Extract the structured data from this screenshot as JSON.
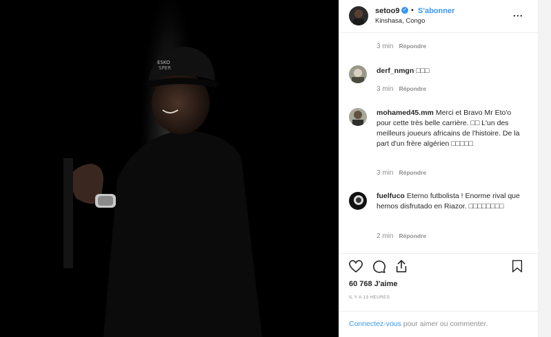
{
  "post": {
    "username": "setoo9",
    "separator": "•",
    "follow_label": "S'abonner",
    "location": "Kinshasa, Congo",
    "more_icon": "..."
  },
  "comments": [
    {
      "username": "",
      "text": "",
      "time": "3 min",
      "reply_label": "Répondre"
    },
    {
      "username": "derf_nmgn",
      "text": "□□□",
      "time": "3 min",
      "reply_label": "Répondre"
    },
    {
      "username": "mohamed45.mm",
      "text": "Merci et Bravo Mr Eto'o pour cette très belle carrière. □□ L'un des meilleurs joueurs africains de l'histoire. De la part d'un frère algérien □□□□□",
      "time": "3 min",
      "reply_label": "Répondre"
    },
    {
      "username": "fuelfuco",
      "text": "Eterno futbolista ! Enorme rival que hemos disfrutado en Riazor. □□□□□□□□",
      "time": "2 min",
      "reply_label": "Répondre"
    }
  ],
  "actions": {
    "icons": [
      "heart-icon",
      "comment-icon",
      "share-icon",
      "bookmark-icon"
    ],
    "likes": "60 768 J'aime",
    "posted": "IL Y A 13 HEURES"
  },
  "footer": {
    "login_link": "Connectez-vous",
    "login_suffix": " pour aimer ou commenter."
  },
  "photo_cap_text": "ESKO SPER"
}
